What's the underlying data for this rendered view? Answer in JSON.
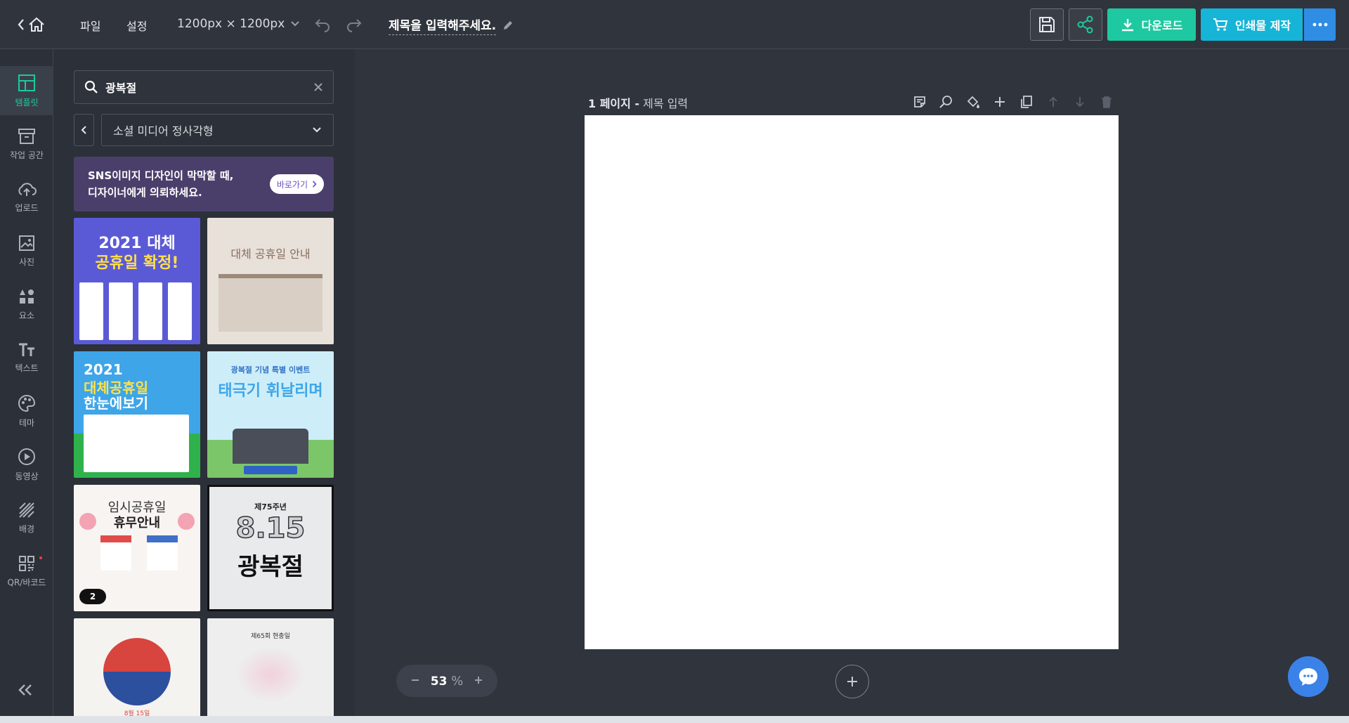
{
  "topbar": {
    "menu_file": "파일",
    "menu_settings": "설정",
    "size": "1200px × 1200px",
    "title": "제목을 입력해주세요.",
    "download": "다운로드",
    "print": "인쇄물 제작"
  },
  "rail": {
    "items": [
      {
        "label": "템플릿",
        "icon": "template-icon"
      },
      {
        "label": "작업 공간",
        "icon": "workspace-icon"
      },
      {
        "label": "업로드",
        "icon": "upload-icon"
      },
      {
        "label": "사진",
        "icon": "photo-icon"
      },
      {
        "label": "요소",
        "icon": "elements-icon"
      },
      {
        "label": "텍스트",
        "icon": "text-icon"
      },
      {
        "label": "테마",
        "icon": "theme-icon"
      },
      {
        "label": "동영상",
        "icon": "video-icon"
      },
      {
        "label": "배경",
        "icon": "background-icon"
      },
      {
        "label": "QR/바코드",
        "icon": "qr-icon"
      }
    ]
  },
  "panel": {
    "search_value": "광복절",
    "category": "소셜 미디어 정사각형",
    "banner_line1": "SNS이미지 디자인이 막막할 때,",
    "banner_line2": "디자이너에게 의뢰하세요.",
    "banner_button": "바로가기",
    "templates": {
      "t1_title1": "2021 대체",
      "t1_title2": "공휴일 확정!",
      "t2_title": "대체 공휴일 안내",
      "t3_title1": "2021",
      "t3_title2": "대체공휴일",
      "t3_title3": "한눈에보기",
      "t4_sub": "광복절 기념 특별 이벤트",
      "t4_title": "태극기 휘날리며",
      "t5_title1": "임시공휴일",
      "t5_title2": "휴무안내",
      "t5_badge": "2",
      "t6_sub": "제75주년",
      "t6_num": "8.15",
      "t6_title": "광복절",
      "t7_caption": "8월 15일",
      "t8_sub": "제65회 현충일"
    }
  },
  "canvas": {
    "page_number": "1 페이지 -",
    "page_title": "제목 입력",
    "zoom_value": "53",
    "zoom_unit": "%"
  }
}
